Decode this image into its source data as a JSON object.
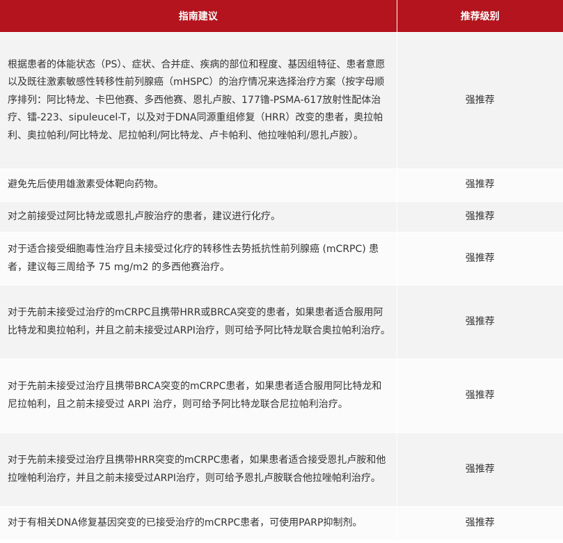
{
  "table": {
    "headers": {
      "recommendation": "指南建议",
      "level": "推荐级别"
    },
    "rows": [
      {
        "recommendation": "根据患者的体能状态（PS）、症状、合并症、疾病的部位和程度、基因组特征、患者意愿以及既往激素敏感性转移性前列腺癌（mHSPC）的治疗情况来选择治疗方案（按字母顺序排列：阿比特龙、卡巴他赛、多西他赛、恩扎卢胺、177镥-PSMA-617放射性配体治疗、镭-223、sipuleucel-T，以及对于DNA同源重组修复（HRR）改变的患者，奥拉帕利、奥拉帕利/阿比特龙、尼拉帕利/阿比特龙、卢卡帕利、他拉唑帕利/恩扎卢胺）。",
        "level": "强推荐"
      },
      {
        "recommendation": "避免先后使用雄激素受体靶向药物。",
        "level": "强推荐"
      },
      {
        "recommendation": "对之前接受过阿比特龙或恩扎卢胺治疗的患者，建议进行化疗。",
        "level": "强推荐"
      },
      {
        "recommendation": "对于适合接受细胞毒性治疗且未接受过化疗的转移性去势抵抗性前列腺癌 (mCRPC) 患者，建议每三周给予 75 mg/m2 的多西他赛治疗。",
        "level": "强推荐"
      },
      {
        "recommendation": "对于先前未接受过治疗的mCRPC且携带HRR或BRCA突变的患者，如果患者适合服用阿比特龙和奥拉帕利，并且之前未接受过ARPI治疗，则可给予阿比特龙联合奥拉帕利治疗。",
        "level": "强推荐"
      },
      {
        "recommendation": "对于先前未接受过治疗且携带BRCA突变的mCRPC患者，如果患者适合服用阿比特龙和尼拉帕利，且之前未接受过 ARPI 治疗，则可给予阿比特龙联合尼拉帕利治疗。",
        "level": "强推荐"
      },
      {
        "recommendation": "对于先前未接受过治疗且携带HRR突变的mCRPC患者，如果患者适合接受恩扎卢胺和他拉唑帕利治疗，并且之前未接受过ARPI治疗，则可给予恩扎卢胺联合他拉唑帕利治疗。",
        "level": "强推荐"
      },
      {
        "recommendation": "对于有相关DNA修复基因突变的已接受治疗的mCRPC患者，可使用PARP抑制剂。",
        "level": "强推荐"
      }
    ]
  },
  "colors": {
    "header_background": "#b3141e",
    "header_text": "#ffffff",
    "row_odd": "#f3f3f3",
    "row_even": "#fbfbfb",
    "body_text": "#333333"
  }
}
